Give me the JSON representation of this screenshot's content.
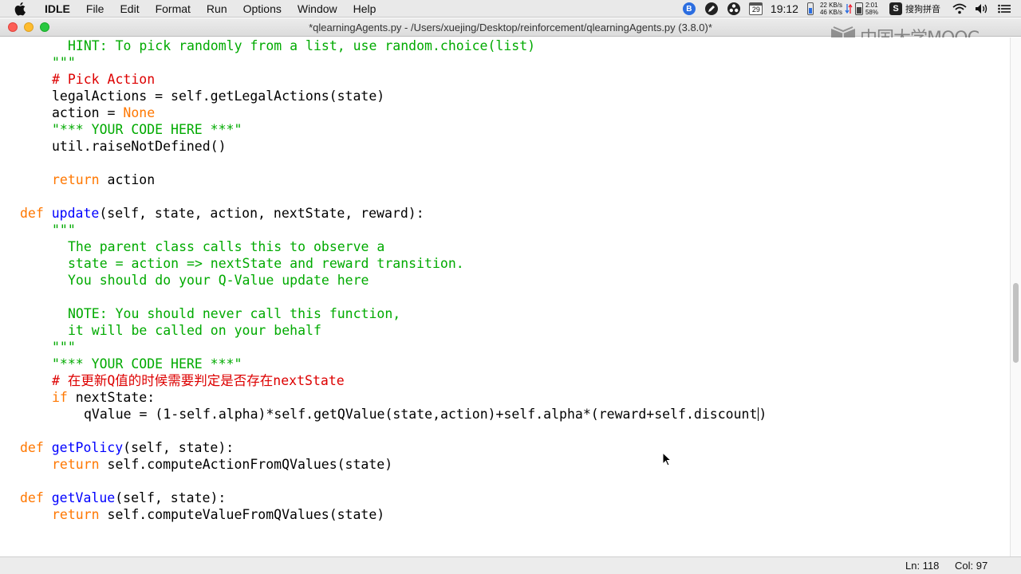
{
  "menubar": {
    "app": "IDLE",
    "items": [
      "File",
      "Edit",
      "Format",
      "Run",
      "Options",
      "Window",
      "Help"
    ],
    "status": {
      "calendar_day": "29",
      "clock": "19:12",
      "net_up": "22 KB/s",
      "net_down": "46 KB/s",
      "battery_time": "2:01",
      "battery_pct": "58%",
      "battery_level": 0.58,
      "ime_label": "搜狗拼音",
      "icons": [
        "bluetooth-icon",
        "pen-icon",
        "obs-icon",
        "calendar-icon",
        "memory-icon",
        "network-speed-icon",
        "battery-icon",
        "sogou-icon",
        "wifi-icon",
        "volume-icon",
        "menu-list-icon"
      ]
    }
  },
  "window": {
    "title": "*qlearningAgents.py - /Users/xuejing/Desktop/reinforcement/qlearningAgents.py (3.8.0)*"
  },
  "watermark": {
    "text": "中国大学MOOC"
  },
  "editor": {
    "lines": [
      {
        "indent": 8,
        "tokens": [
          {
            "t": "HINT: To pick randomly from a list, use random.choice(list)",
            "c": "str"
          }
        ]
      },
      {
        "indent": 6,
        "tokens": [
          {
            "t": "\"\"\"",
            "c": "str"
          }
        ]
      },
      {
        "indent": 6,
        "tokens": [
          {
            "t": "# Pick Action",
            "c": "cmt"
          }
        ]
      },
      {
        "indent": 6,
        "tokens": [
          {
            "t": "legalActions = self.getLegalActions(state)",
            "c": ""
          }
        ]
      },
      {
        "indent": 6,
        "tokens": [
          {
            "t": "action = ",
            "c": ""
          },
          {
            "t": "None",
            "c": "kw"
          }
        ]
      },
      {
        "indent": 6,
        "tokens": [
          {
            "t": "\"*** YOUR CODE HERE ***\"",
            "c": "str"
          }
        ]
      },
      {
        "indent": 6,
        "tokens": [
          {
            "t": "util.raiseNotDefined()",
            "c": ""
          }
        ]
      },
      {
        "indent": 0,
        "tokens": []
      },
      {
        "indent": 6,
        "tokens": [
          {
            "t": "return",
            "c": "kw"
          },
          {
            "t": " action",
            "c": ""
          }
        ]
      },
      {
        "indent": 0,
        "tokens": []
      },
      {
        "indent": 2,
        "tokens": [
          {
            "t": "def",
            "c": "kw"
          },
          {
            "t": " ",
            "c": ""
          },
          {
            "t": "update",
            "c": "fn"
          },
          {
            "t": "(self, state, action, nextState, reward):",
            "c": ""
          }
        ]
      },
      {
        "indent": 6,
        "tokens": [
          {
            "t": "\"\"\"",
            "c": "str"
          }
        ]
      },
      {
        "indent": 8,
        "tokens": [
          {
            "t": "The parent class calls this to observe a",
            "c": "str"
          }
        ]
      },
      {
        "indent": 8,
        "tokens": [
          {
            "t": "state = action => nextState and reward transition.",
            "c": "str"
          }
        ]
      },
      {
        "indent": 8,
        "tokens": [
          {
            "t": "You should do your Q-Value update here",
            "c": "str"
          }
        ]
      },
      {
        "indent": 0,
        "tokens": []
      },
      {
        "indent": 8,
        "tokens": [
          {
            "t": "NOTE: You should never call this function,",
            "c": "str"
          }
        ]
      },
      {
        "indent": 8,
        "tokens": [
          {
            "t": "it will be called on your behalf",
            "c": "str"
          }
        ]
      },
      {
        "indent": 6,
        "tokens": [
          {
            "t": "\"\"\"",
            "c": "str"
          }
        ]
      },
      {
        "indent": 6,
        "tokens": [
          {
            "t": "\"*** YOUR CODE HERE ***\"",
            "c": "str"
          }
        ]
      },
      {
        "indent": 6,
        "tokens": [
          {
            "t": "# 在更新Q值的时候需要判定是否存在nextState",
            "c": "cmt"
          }
        ]
      },
      {
        "indent": 6,
        "tokens": [
          {
            "t": "if",
            "c": "kw"
          },
          {
            "t": " nextState:",
            "c": ""
          }
        ]
      },
      {
        "indent": 10,
        "tokens": [
          {
            "t": "qValue = (1-self.alpha)*self.getQValue(state,action)+self.alpha*(reward+self.discount",
            "c": ""
          },
          {
            "t": "",
            "c": "cursor"
          },
          {
            "t": ")",
            "c": ""
          }
        ]
      },
      {
        "indent": 0,
        "tokens": []
      },
      {
        "indent": 2,
        "tokens": [
          {
            "t": "def",
            "c": "kw"
          },
          {
            "t": " ",
            "c": ""
          },
          {
            "t": "getPolicy",
            "c": "fn"
          },
          {
            "t": "(self, state):",
            "c": ""
          }
        ]
      },
      {
        "indent": 6,
        "tokens": [
          {
            "t": "return",
            "c": "kw"
          },
          {
            "t": " self.computeActionFromQValues(state)",
            "c": ""
          }
        ]
      },
      {
        "indent": 0,
        "tokens": []
      },
      {
        "indent": 2,
        "tokens": [
          {
            "t": "def",
            "c": "kw"
          },
          {
            "t": " ",
            "c": ""
          },
          {
            "t": "getValue",
            "c": "fn"
          },
          {
            "t": "(self, state):",
            "c": ""
          }
        ]
      },
      {
        "indent": 6,
        "tokens": [
          {
            "t": "return",
            "c": "kw"
          },
          {
            "t": " self.computeValueFromQValues(state)",
            "c": ""
          }
        ]
      }
    ]
  },
  "statusbar": {
    "ln": "Ln: 118",
    "col": "Col: 97"
  }
}
